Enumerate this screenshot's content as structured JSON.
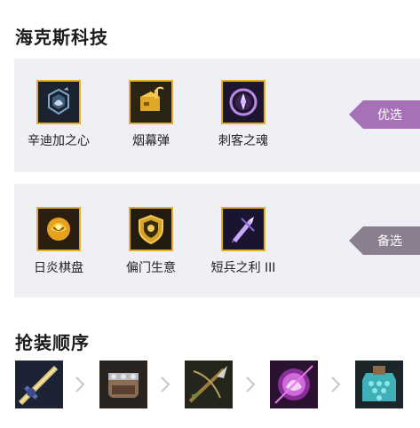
{
  "hextech": {
    "title": "海克斯科技",
    "primary": {
      "tag": "优选",
      "tag_color": "#a671b6",
      "augments": [
        {
          "name": "辛迪加之心",
          "icon": "syndicate-heart-icon"
        },
        {
          "name": "烟幕弹",
          "icon": "smoke-bomb-icon"
        },
        {
          "name": "刺客之魂",
          "icon": "assassin-soul-icon"
        }
      ]
    },
    "alternate": {
      "tag": "备选",
      "tag_color": "#8a7f8e",
      "augments": [
        {
          "name": "日炎棋盘",
          "icon": "solar-board-icon"
        },
        {
          "name": "偏门生意",
          "icon": "side-hustle-icon"
        },
        {
          "name": "短兵之利 III",
          "icon": "short-blade-icon"
        }
      ]
    }
  },
  "build": {
    "title": "抢装顺序",
    "items": [
      {
        "icon": "sword-item-icon"
      },
      {
        "icon": "fist-item-icon"
      },
      {
        "icon": "spear-item-icon"
      },
      {
        "icon": "orb-item-icon"
      },
      {
        "icon": "armor-item-icon"
      }
    ]
  },
  "colors": {
    "accent_gold": "#e8ad28",
    "panel_bg": "#eef0f5"
  }
}
